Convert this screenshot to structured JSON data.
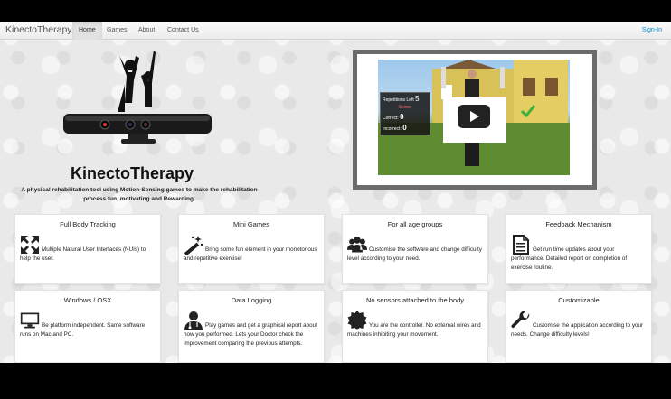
{
  "navbar": {
    "brand": "KinectoTherapy",
    "links": [
      "Home",
      "Games",
      "About",
      "Contact Us"
    ],
    "sign_in": "Sign-In"
  },
  "hero": {
    "title": "KinectoTherapy",
    "tagline": "A physical rehabilitation tool using Motion-Sensing games to make the rehabilitation process fun, motivating and Rewarding."
  },
  "video": {
    "overlay": {
      "repetitions_label": "Repetitions Left",
      "repetitions_value": "5",
      "score_label": "Score:",
      "correct_label": "Correct:",
      "correct_value": "0",
      "incorrect_label": "Incorrect:",
      "incorrect_value": "0"
    }
  },
  "features": [
    {
      "title": "Full Body Tracking",
      "icon": "expand-arrows-icon",
      "text": "Multiple Natural User Interfaces (NUIs) to help the user."
    },
    {
      "title": "Mini Games",
      "icon": "magic-wand-icon",
      "text": "Bring some fun element in your monotonous and repetitive exercise!"
    },
    {
      "title": "For all age groups",
      "icon": "group-icon",
      "text": "Customise the software and change difficulty level according to your need."
    },
    {
      "title": "Feedback Mechanism",
      "icon": "document-icon",
      "text": "Get run time updates about your performance. Detailed report on completion of exercise routine."
    },
    {
      "title": "Windows / OSX",
      "icon": "monitor-icon",
      "text": "Be platform independent. Same software runs on Mac and PC."
    },
    {
      "title": "Data Logging",
      "icon": "doctor-icon",
      "text": "Play games and get a graphical report about how you performed. Lets your Doctor check the improvement comparing the previous attempts."
    },
    {
      "title": "No sensors attached to the body",
      "icon": "badge-icon",
      "text": "You are the controller. No external wires and machines inhibiting your movement."
    },
    {
      "title": "Customizable",
      "icon": "wrench-icon",
      "text": "Customise the application according to your needs. Change difficulty levels!"
    }
  ]
}
